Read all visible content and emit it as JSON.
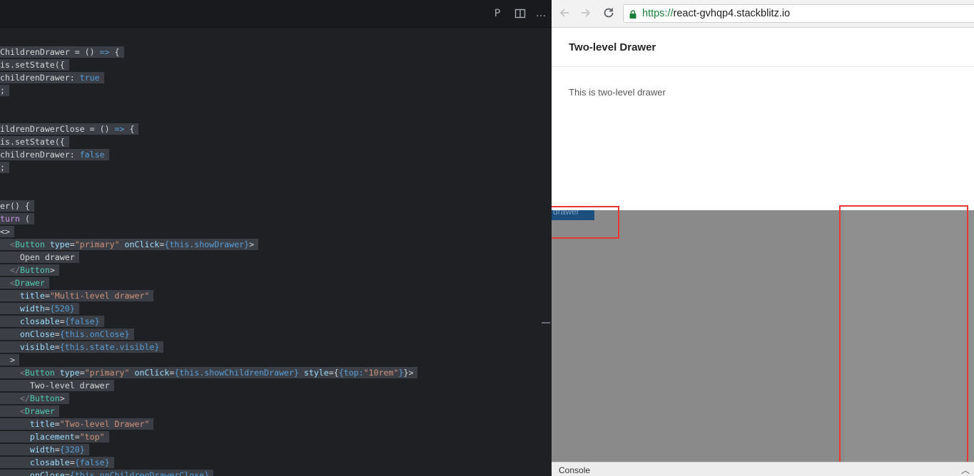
{
  "editor": {
    "toolbar": {
      "preview_icon": "P",
      "split_icon": "split-view-icon",
      "more_icon": "…"
    },
    "lines": [
      "ChildrenDrawer = () => {",
      "is.setState({",
      "childrenDrawer: true",
      ";",
      "",
      "",
      "ildrenDrawerClose = () => {",
      "is.setState({",
      "childrenDrawer: false",
      ";",
      "",
      "",
      "er() {",
      "turn (",
      "<>",
      "  <Button type=\"primary\" onClick={this.showDrawer}>",
      "    Open drawer",
      "  </Button>",
      "  <Drawer",
      "    title=\"Multi-level drawer\"",
      "    width={520}",
      "    closable={false}",
      "    onClose={this.onClose}",
      "    visible={this.state.visible}",
      "  >",
      "    <Button type=\"primary\" onClick={this.showChildrenDrawer} style={{top:\"10rem\"}}>",
      "      Two-level drawer",
      "    </Button>",
      "    <Drawer",
      "      title=\"Two-level Drawer\"",
      "      placement=\"top\"",
      "      width={320}",
      "      closable={false}",
      "      onClose={this.onChildrenDrawerClose}"
    ]
  },
  "browser": {
    "url_scheme": "https://",
    "url_host": "react-gvhqp4.stackblitz.io",
    "drawer": {
      "title": "Two-level Drawer",
      "body": "This is two-level drawer"
    },
    "hidden_button_label": "drawer",
    "console_label": "Console"
  },
  "colors": {
    "highlight_box": "#e53935",
    "mask": "#8a8a8a",
    "https_green": "#188038"
  }
}
